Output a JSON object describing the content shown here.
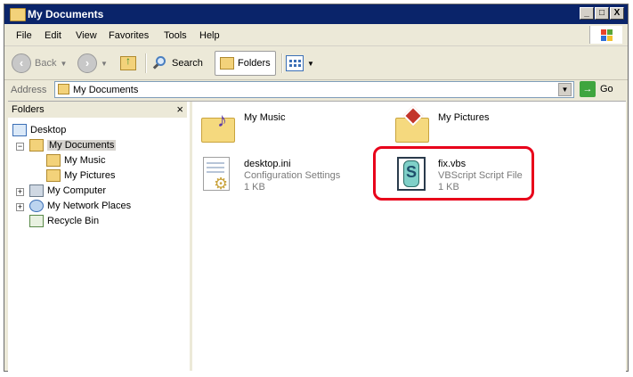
{
  "window": {
    "title": "My Documents",
    "controls": {
      "minimize": "_",
      "maximize": "□",
      "close": "X"
    }
  },
  "menu": [
    "File",
    "Edit",
    "View",
    "Favorites",
    "Tools",
    "Help"
  ],
  "toolbar": {
    "back_label": "Back",
    "search_label": "Search",
    "folders_label": "Folders"
  },
  "address": {
    "label": "Address",
    "value": "My Documents",
    "go_label": "Go"
  },
  "folders_pane": {
    "title": "Folders",
    "close": "×",
    "tree": [
      {
        "label": "Desktop"
      },
      {
        "label": "My Documents",
        "expander": "−"
      },
      {
        "label": "My Music"
      },
      {
        "label": "My Pictures"
      },
      {
        "label": "My Computer",
        "expander": "+"
      },
      {
        "label": "My Network Places",
        "expander": "+"
      },
      {
        "label": "Recycle Bin"
      }
    ]
  },
  "files": [
    {
      "name": "My Music"
    },
    {
      "name": "My Pictures"
    },
    {
      "name": "desktop.ini",
      "type": "Configuration Settings",
      "size": "1 KB"
    },
    {
      "name": "fix.vbs",
      "type": "VBScript Script File",
      "size": "1 KB"
    }
  ],
  "colors": {
    "titlebar": "#0a246a",
    "highlight_ring": "#e8001a",
    "selection": "#d6d3ce"
  }
}
